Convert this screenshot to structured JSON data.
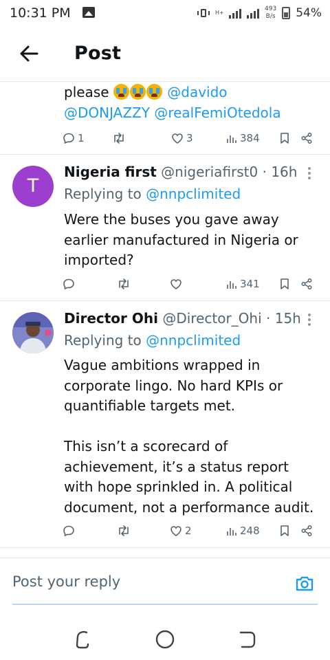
{
  "status_bar": {
    "time": "10:31 PM",
    "net_type": "H+",
    "speed_value": "493",
    "speed_unit": "B/s",
    "battery": "54%",
    "icons": [
      "gallery-icon",
      "vibrate-icon",
      "signal-icon",
      "battery-icon"
    ]
  },
  "header": {
    "title": "Post",
    "back_icon": "arrow-left-icon"
  },
  "tweets": [
    {
      "text_lines": [
        "please",
        "@davido",
        "@DONJAZZY",
        "@realFemiOtedola"
      ],
      "emoji": "loudly-crying-face x3",
      "actions": {
        "replies": "1",
        "reposts": "",
        "likes": "3",
        "views": "384"
      }
    },
    {
      "name": "Nigeria first",
      "handle": "@nigeriafirst0",
      "time": "· 16h",
      "avatar_letter": "T",
      "replying_prefix": "Replying to",
      "replying_to": "@nnpclimited",
      "text": "Were the buses you gave away\nearlier manufactured in Nigeria or\nimported?",
      "actions": {
        "replies": "",
        "reposts": "",
        "likes": "",
        "views": "341"
      }
    },
    {
      "name": "Director Ohi",
      "handle": "@Director_Ohi",
      "time": "· 15h",
      "replying_prefix": "Replying to",
      "replying_to": "@nnpclimited",
      "text": "Vague ambitions wrapped in\ncorporate lingo. No hard KPIs or\nquantifiable targets met.\n\nThis isn’t a scorecard of\nachievement, it’s a status report\nwith hope sprinkled in. A political\ndocument, not a performance audit.",
      "actions": {
        "replies": "",
        "reposts": "",
        "likes": "2",
        "views": "248"
      }
    }
  ],
  "composer": {
    "placeholder": "Post your reply",
    "camera_icon": "camera-icon"
  },
  "colors": {
    "accent": "#1d9bf0",
    "text": "#0f1419",
    "secondary": "#536471",
    "avatar_purple": "#9c3fce"
  }
}
